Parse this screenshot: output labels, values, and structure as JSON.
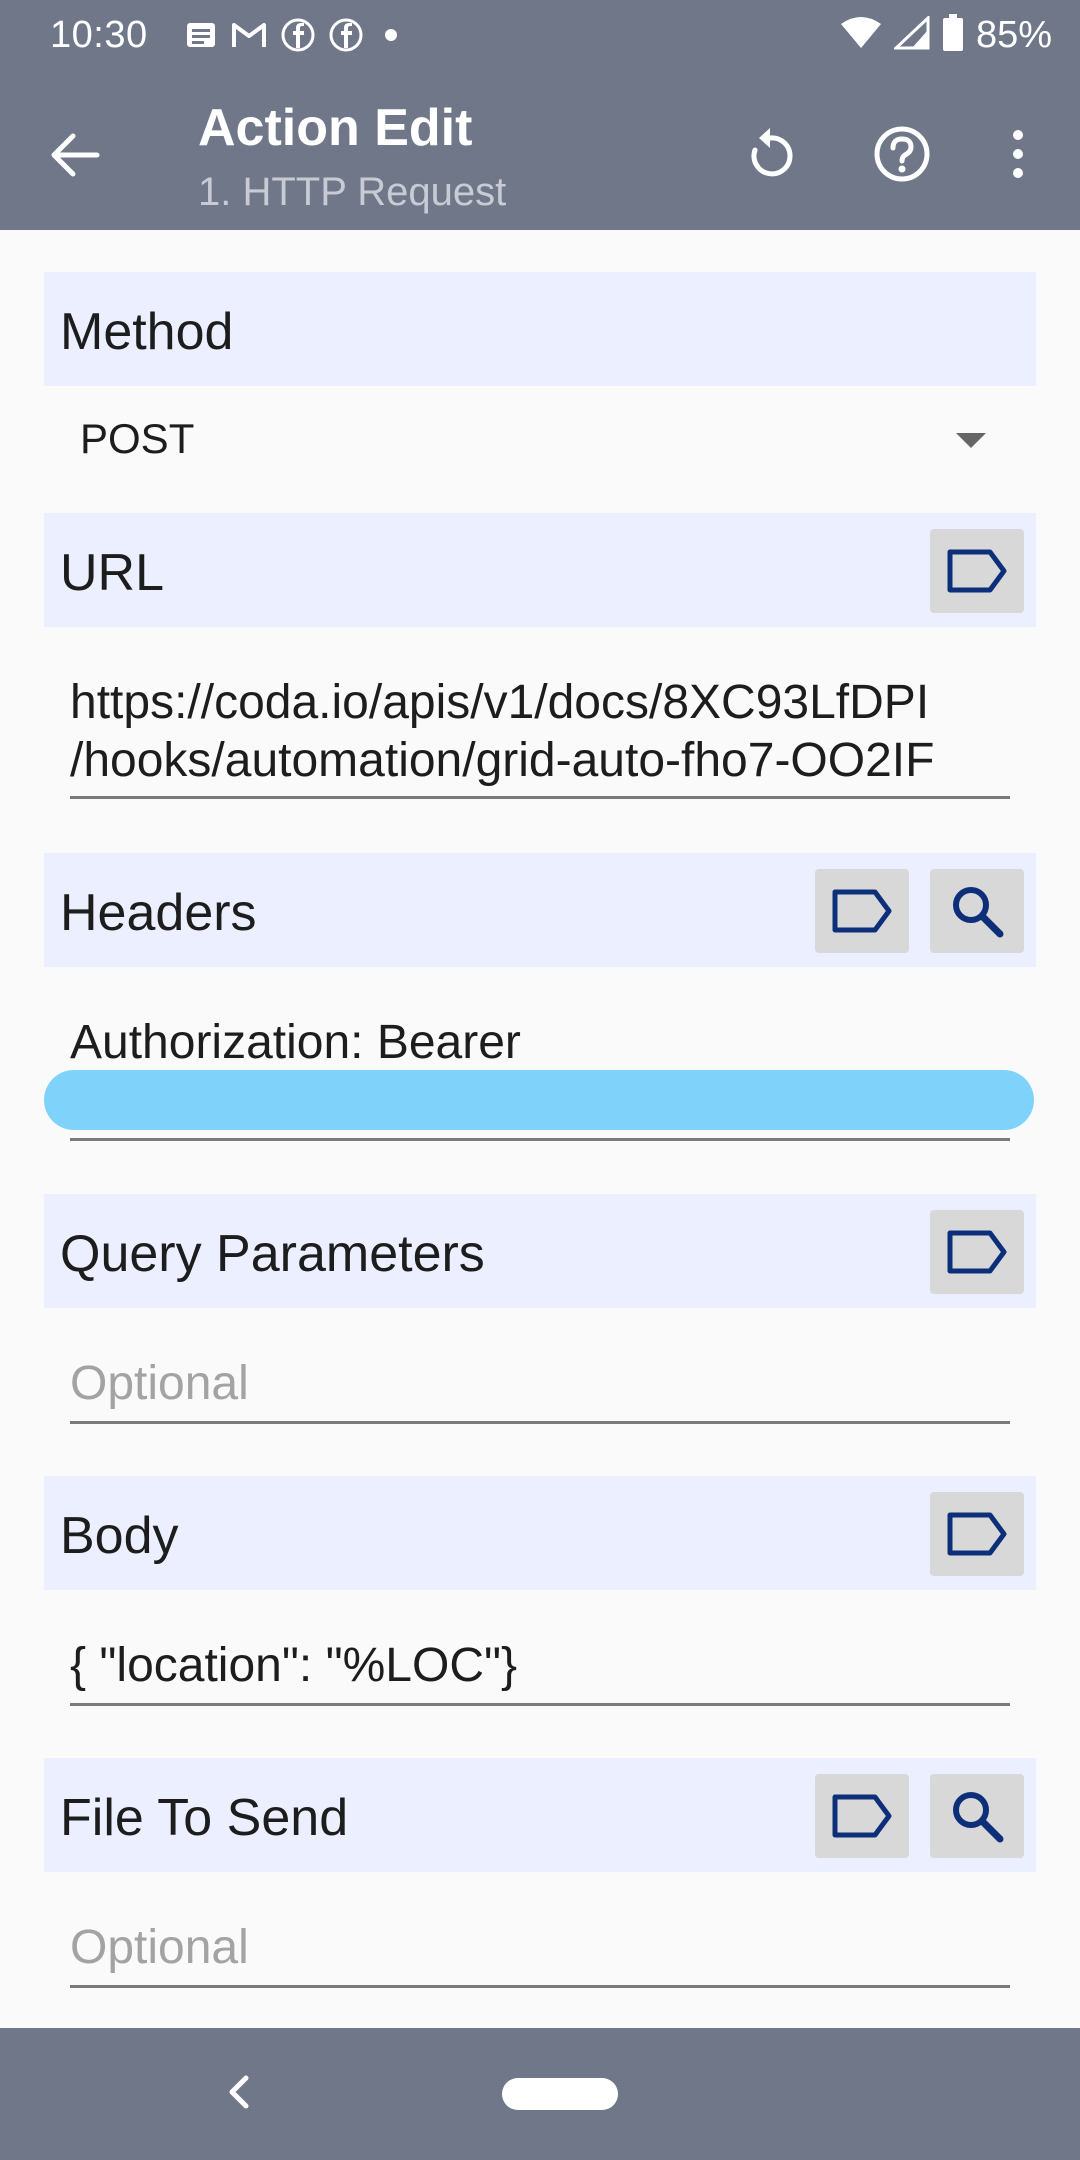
{
  "status_bar": {
    "time": "10:30",
    "battery": "85%",
    "notification_icons": [
      "message-icon",
      "gmail-icon",
      "facebook-icon",
      "facebook-icon",
      "dot-icon"
    ],
    "system_icons": [
      "wifi-icon",
      "signal-icon",
      "battery-icon"
    ]
  },
  "app_bar": {
    "title": "Action Edit",
    "subtitle": "1. HTTP Request",
    "actions": [
      "undo-icon",
      "help-icon",
      "more-vert-icon"
    ]
  },
  "form": {
    "method": {
      "label": "Method",
      "value": "POST"
    },
    "url": {
      "label": "URL",
      "value_line1": "https://coda.io/apis/v1/docs/8XC93LfDPI",
      "value_line2": "/hooks/automation/grid-auto-fho7-OO2IF"
    },
    "headers": {
      "label": "Headers",
      "value_line1": "Authorization: Bearer"
    },
    "query_parameters": {
      "label": "Query Parameters",
      "placeholder": "Optional"
    },
    "body": {
      "label": "Body",
      "value": "{ \"location\": \"%LOC\"}"
    },
    "file_to_send": {
      "label": "File To Send",
      "placeholder": "Optional"
    }
  },
  "colors": {
    "app_bar": "#707789",
    "section_header_bg": "#ebefff",
    "icon_blue": "#0d2f7a",
    "redaction": "#7fd3fb"
  }
}
